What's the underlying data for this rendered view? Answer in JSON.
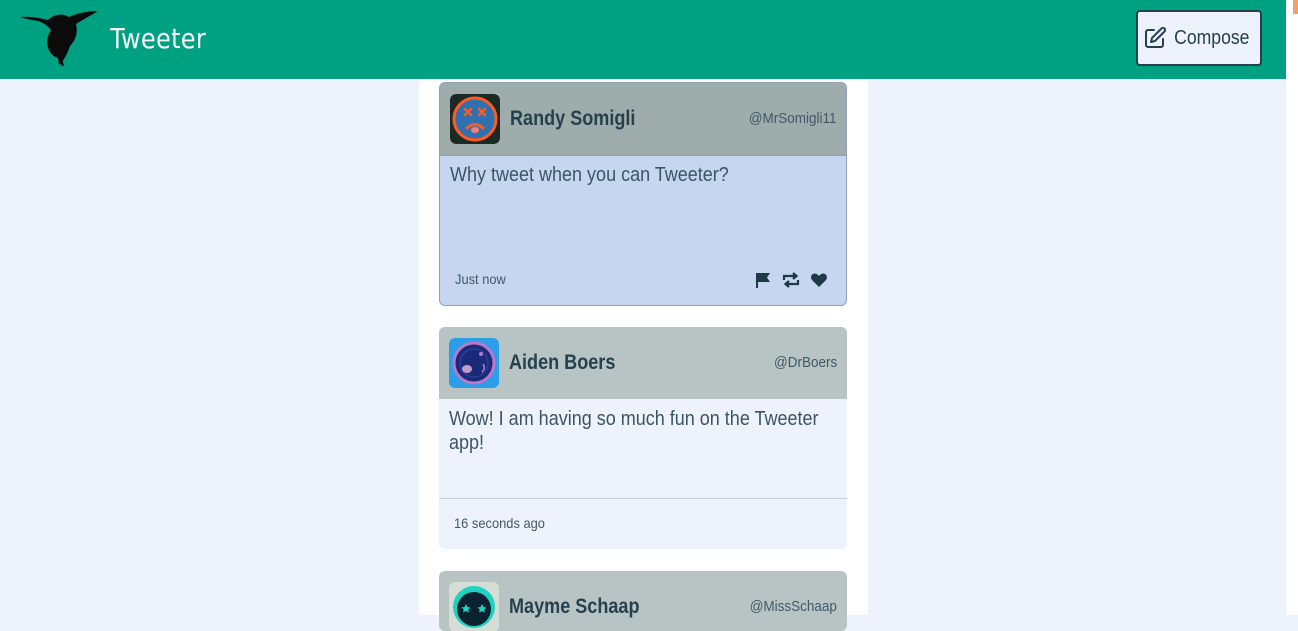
{
  "app": {
    "title": "Tweeter",
    "logo_icon": "hummingbird-icon"
  },
  "header": {
    "compose_label": "Compose",
    "compose_icon": "edit-icon",
    "background": "#00a083"
  },
  "tweets": [
    {
      "name": "Randy Somigli",
      "handle": "@MrSomigli11",
      "text": "Why tweet when you can Tweeter?",
      "time": "Just now",
      "avatar_icon": "dizzy-face-avatar",
      "state": "hovered",
      "actions": [
        "flag-icon",
        "retweet-icon",
        "heart-icon"
      ]
    },
    {
      "name": "Aiden Boers",
      "handle": "@DrBoers",
      "text": "Wow! I am having so much fun on the Tweeter app!",
      "time": "16 seconds ago",
      "avatar_icon": "planet-avatar"
    },
    {
      "name": "Mayme Schaap",
      "handle": "@MissSchaap",
      "avatar_icon": "star-face-avatar"
    }
  ]
}
